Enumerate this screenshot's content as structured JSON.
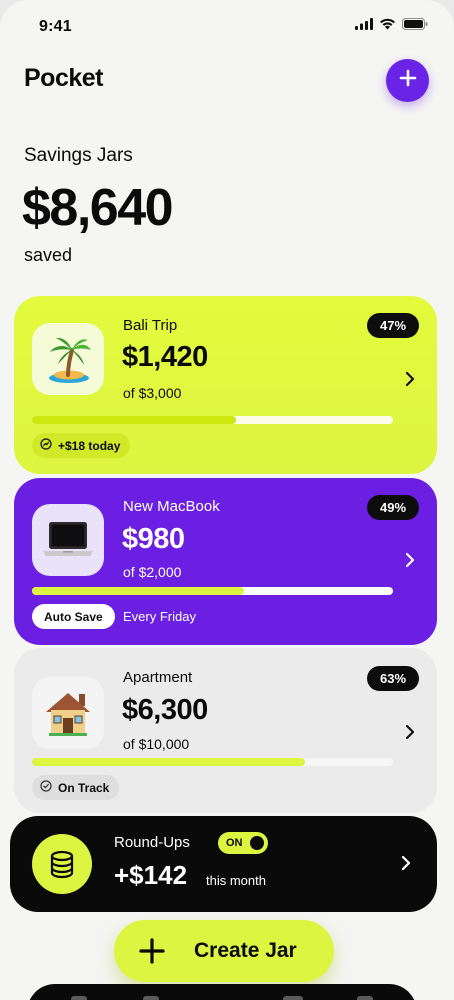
{
  "status": {
    "time": "9:41"
  },
  "header": {
    "title": "Pocket",
    "add_icon": "plus-icon"
  },
  "summary": {
    "label": "Savings Jars",
    "total": "$8,640",
    "caption": "saved"
  },
  "jars": [
    {
      "name": "Bali Trip",
      "amount": "$1,420",
      "goal": "of $3,000",
      "percent_label": "47%",
      "progress": 0.47,
      "icon": "palm-island-icon",
      "chip_label": "+$18 today",
      "chip_icon": "trend-up-icon",
      "color": "#dcf541"
    },
    {
      "name": "New MacBook",
      "amount": "$980",
      "goal": "of $2,000",
      "percent_label": "49%",
      "progress": 0.49,
      "icon": "laptop-icon",
      "auto_save_label": "Auto Save",
      "schedule": "Every Friday",
      "color": "#6a1fe3"
    },
    {
      "name": "Apartment",
      "amount": "$6,300",
      "goal": "of $10,000",
      "percent_label": "63%",
      "progress": 0.63,
      "icon": "house-icon",
      "chip_label": "On Track",
      "chip_icon": "check-circle-icon",
      "color": "#ebebeb"
    }
  ],
  "roundups": {
    "title": "Round-Ups",
    "toggle_label": "ON",
    "toggle_on": true,
    "amount": "+$142",
    "period": "this month",
    "icon": "coins-stack-icon"
  },
  "actions": {
    "create_label": "Create Jar"
  },
  "colors": {
    "accent": "#6a24e6",
    "lime": "#dcf541",
    "dark": "#0a0a0a"
  }
}
